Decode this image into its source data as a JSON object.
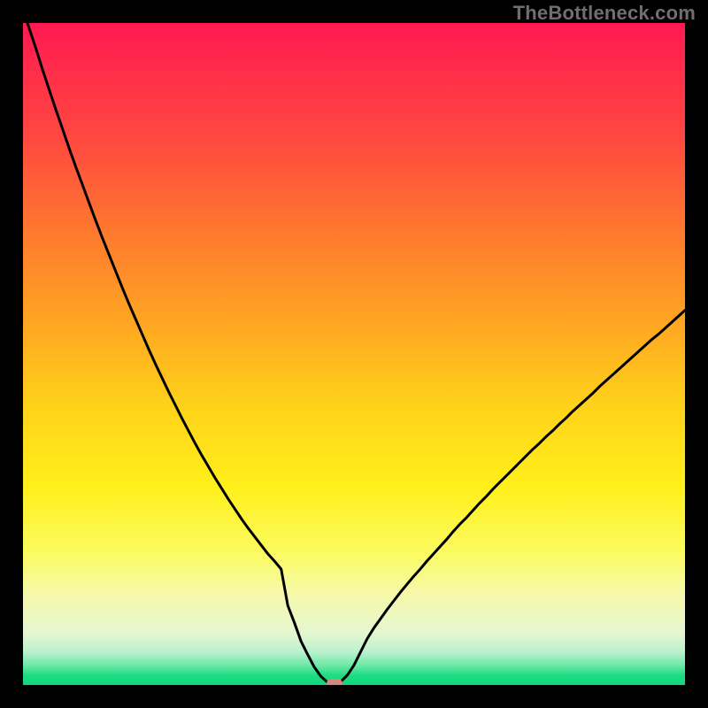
{
  "watermark": "TheBottleneck.com",
  "colors": {
    "page_bg": "#000000",
    "curve": "#000000",
    "minpoint": "#d7857e",
    "gradient_top": "#ff1850",
    "gradient_bottom": "#0fd77d"
  },
  "chart_data": {
    "type": "line",
    "title": "",
    "xlabel": "",
    "ylabel": "",
    "xlim": [
      0,
      100
    ],
    "ylim": [
      0,
      100
    ],
    "x": [
      0,
      1,
      2,
      3,
      4,
      5,
      6,
      7,
      8,
      9,
      10,
      11,
      12,
      13,
      14,
      15,
      16,
      17,
      18,
      19,
      20,
      21,
      22,
      23,
      24,
      25,
      26,
      27,
      28,
      29,
      30,
      31,
      32,
      33,
      34,
      35,
      36,
      37,
      38,
      39,
      40,
      41,
      42,
      43,
      44,
      45,
      46,
      47,
      48,
      49,
      50,
      51,
      52,
      53,
      54,
      55,
      56,
      57,
      58,
      59,
      60,
      61,
      62,
      63,
      64,
      65,
      66,
      67,
      68,
      69,
      70,
      71,
      72,
      73,
      74,
      75,
      76,
      77,
      78,
      79,
      80,
      81,
      82,
      83,
      84,
      85,
      86,
      87,
      88,
      89,
      90,
      91,
      92,
      93,
      94,
      95,
      96,
      97,
      98,
      99,
      100
    ],
    "series": [
      {
        "name": "bottleneck-curve",
        "values": [
          102,
          99,
          96,
          92.8,
          89.8,
          86.8,
          83.9,
          81,
          78.2,
          75.5,
          72.8,
          70.1,
          67.5,
          65,
          62.5,
          60,
          57.6,
          55.3,
          53,
          50.7,
          48.5,
          46.4,
          44.3,
          42.3,
          40.3,
          38.4,
          36.5,
          34.7,
          33,
          31.3,
          29.7,
          28.1,
          26.6,
          25.1,
          23.7,
          22.4,
          21.1,
          19.8,
          18.7,
          17.5,
          12.0,
          9.4,
          6.6,
          4.6,
          2.7,
          1.3,
          0.4,
          0.0,
          0.5,
          1.5,
          3.0,
          5.0,
          7.0,
          8.6,
          10.0,
          11.4,
          12.7,
          14.0,
          15.2,
          16.4,
          17.5,
          18.7,
          19.8,
          20.9,
          22.0,
          23.2,
          24.3,
          25.3,
          26.4,
          27.5,
          28.5,
          29.6,
          30.6,
          31.6,
          32.6,
          33.6,
          34.6,
          35.6,
          36.5,
          37.5,
          38.4,
          39.4,
          40.3,
          41.3,
          42.2,
          43.1,
          44.0,
          45.0,
          45.9,
          46.8,
          47.7,
          48.6,
          49.5,
          50.4,
          51.3,
          52.2,
          53.0,
          53.9,
          54.8,
          55.7,
          56.6
        ]
      }
    ],
    "min_point": {
      "x": 47,
      "y": 0
    },
    "annotations": []
  }
}
